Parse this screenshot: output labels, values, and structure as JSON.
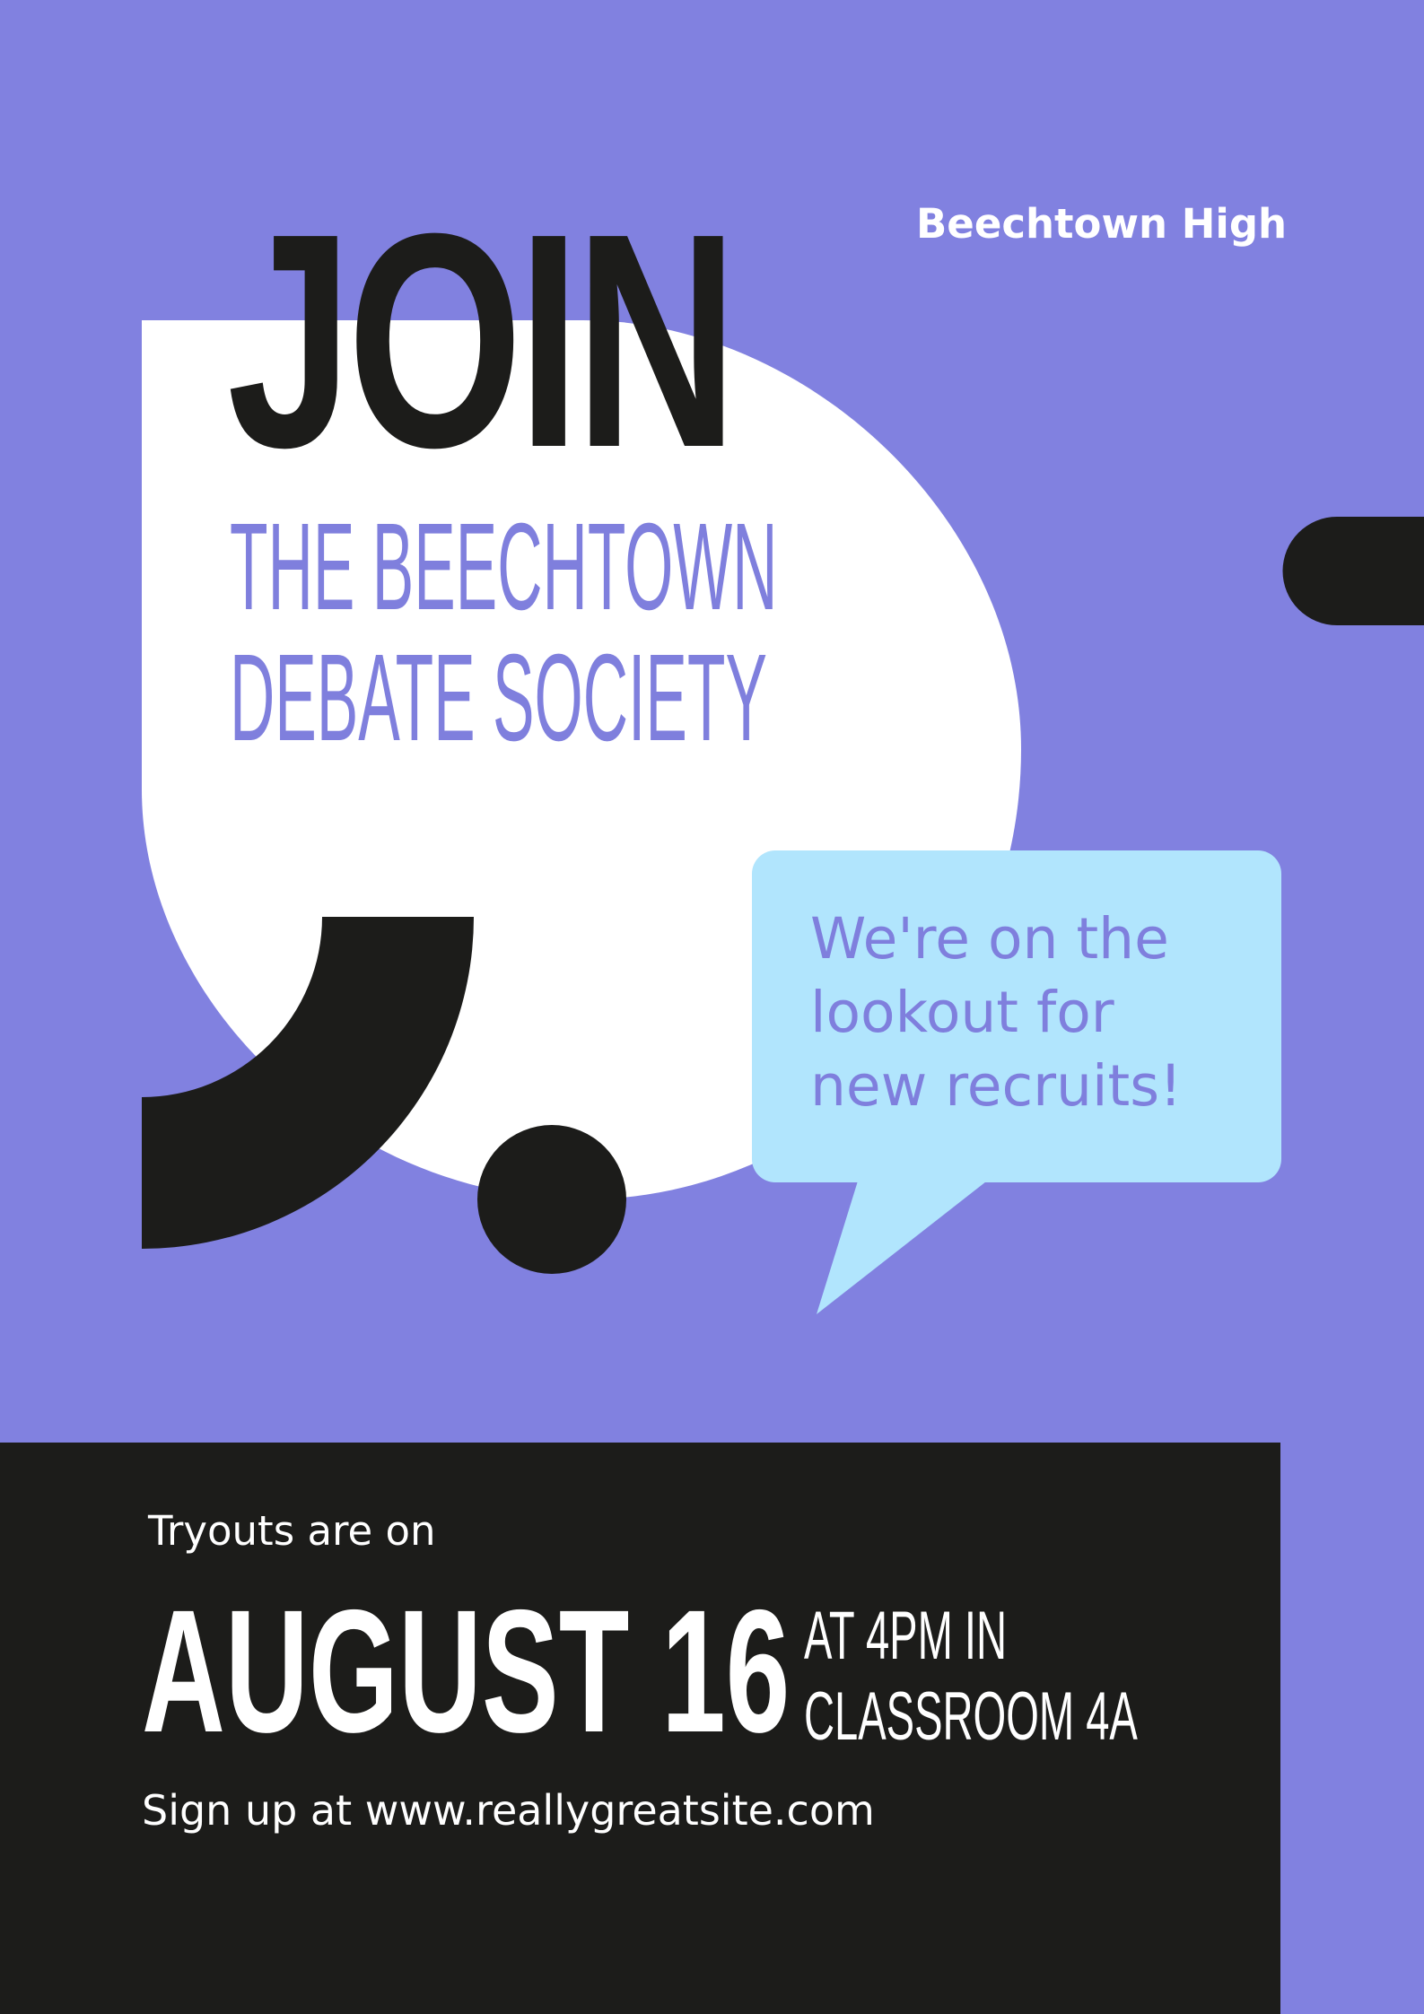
{
  "colors": {
    "background": "#8181e0",
    "accent_text": "#7f7fdd",
    "dark": "#1c1c1a",
    "white": "#ffffff",
    "bubble": "#b1e5fd"
  },
  "header": {
    "school": "Beechtown High",
    "headline": "JOIN",
    "subtitle_line1": "THE BEECHTOWN",
    "subtitle_line2": "DEBATE SOCIETY"
  },
  "speech_bubble": {
    "line1": "We're on the",
    "line2": "lookout for",
    "line3": "new recruits!"
  },
  "event": {
    "intro": "Tryouts are on",
    "date": "AUGUST 16",
    "time_line1": "AT 4PM IN",
    "time_line2": "CLASSROOM 4A",
    "signup": "Sign up at www.reallygreatsite.com"
  }
}
